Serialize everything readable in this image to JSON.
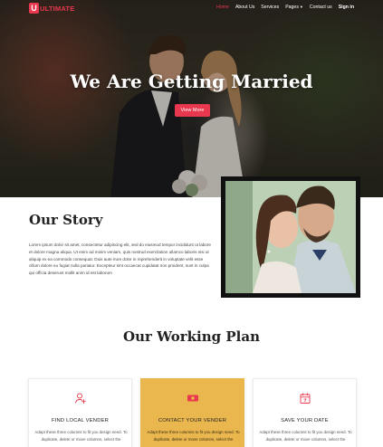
{
  "nav": {
    "logo_letter": "U",
    "logo_text": "ULTIMATE",
    "items": [
      {
        "label": "Home",
        "active": true
      },
      {
        "label": "About Us",
        "active": false
      },
      {
        "label": "Services",
        "active": false
      },
      {
        "label": "Pages",
        "active": false,
        "dropdown": true
      },
      {
        "label": "Contact us",
        "active": false
      },
      {
        "label": "Sign in",
        "active": false
      }
    ]
  },
  "hero": {
    "title": "We Are Getting Married",
    "button_label": "View More"
  },
  "story": {
    "title": "Our Story",
    "text": "Lorem ipsum dolor sit amet, consectetur adipiscing elit, sed do eiusmod tempor incididunt ut labore et dolore magna aliqua. Ut enim ad minim veniam, quis nostrud exercitation ullamco laboris nisi ut aliquip ex ea commodo consequat. Duis aute irure dolor in reprehenderit in voluptate velit esse cillum dolore eu fugiat nulla pariatur. Excepteur sint occaecat cupidatat non proident, sunt in culpa qui officia deserunt mollit anim id est laborum"
  },
  "plan": {
    "title": "Our Working Plan",
    "cards": [
      {
        "title": "FIND LOCAL VENDER",
        "icon": "user-plus-icon",
        "text": "Adapt these three columns to fit you design need. To duplicate, delete or move columns, select the"
      },
      {
        "title": "CONTACT YOUR VENDER",
        "icon": "cash-icon",
        "text": "Adapt these three columns to fit you design need. To duplicate, delete or move columns, select the"
      },
      {
        "title": "SAVE YOUR DATE",
        "icon": "calendar-icon",
        "text": "Adapt these three columns to fit you design need. To duplicate, delete or move columns, select the"
      }
    ]
  },
  "colors": {
    "accent": "#e8384f",
    "featured_card": "#eab64e",
    "icon_accent": "#e8384f"
  }
}
